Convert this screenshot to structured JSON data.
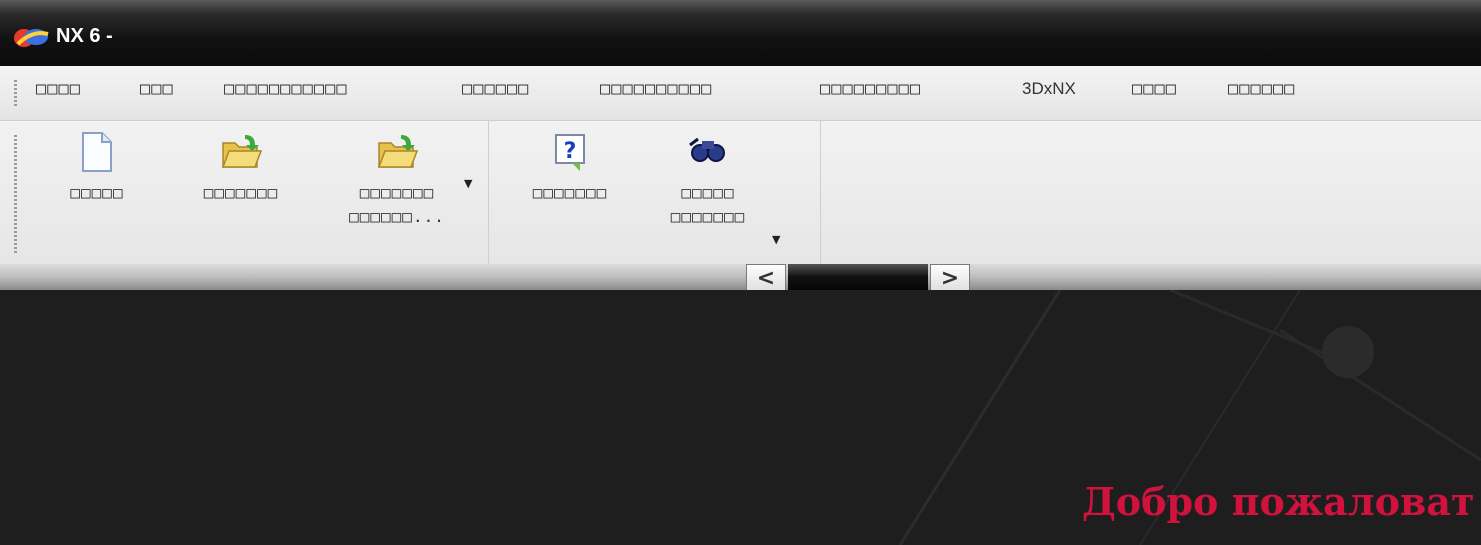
{
  "window": {
    "title": "NX 6 -"
  },
  "menu": {
    "items": [
      {
        "label": "□□□□"
      },
      {
        "label": "□□□"
      },
      {
        "label": "□□□□□□□□□□□"
      },
      {
        "label": "□□□□□□"
      },
      {
        "label": "□□□□□□□□□□"
      },
      {
        "label": "□□□□□□□□□"
      },
      {
        "label": "3DxNX"
      },
      {
        "label": "□□□□"
      },
      {
        "label": "□□□□□□"
      }
    ]
  },
  "toolbar": {
    "buttons": [
      {
        "label": "□□□□□",
        "icon": "new-file-icon"
      },
      {
        "label": "□□□□□□□",
        "icon": "open-folder-icon"
      },
      {
        "label": "□□□□□□□",
        "label2": "□□□□□□...",
        "icon": "open-folder-icon"
      },
      {
        "label": "□□□□□□□",
        "icon": "help-icon"
      },
      {
        "label": "□□□□□",
        "label2": "□□□□□□□",
        "icon": "binoculars-icon"
      }
    ]
  },
  "scroller": {
    "left": "<",
    "right": ">"
  },
  "main": {
    "welcome": "Добро пожаловат"
  },
  "colors": {
    "welcome_text": "#d0123c",
    "background": "#1e1e1e"
  }
}
